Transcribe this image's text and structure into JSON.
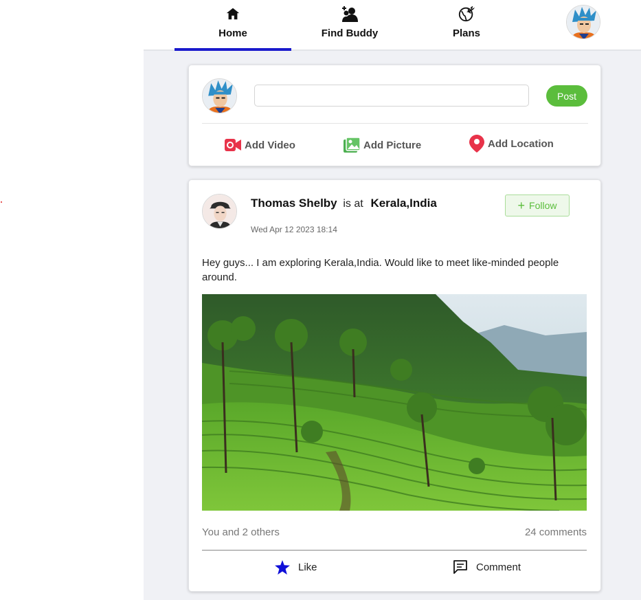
{
  "nav": {
    "items": [
      {
        "label": "Home",
        "icon": "home-icon"
      },
      {
        "label": "Find Buddy",
        "icon": "add-person-icon"
      },
      {
        "label": "Plans",
        "icon": "globe-plane-icon"
      }
    ],
    "active": "Home",
    "accent": "#1a1acc"
  },
  "composer": {
    "input_value": "",
    "post_label": "Post",
    "actions": [
      {
        "label": "Add Video",
        "icon": "video-camera-icon",
        "color": "#e8334a"
      },
      {
        "label": "Add Picture",
        "icon": "image-icon",
        "color": "#4caf50"
      },
      {
        "label": "Add Location",
        "icon": "location-pin-icon",
        "color": "#e8334a"
      }
    ]
  },
  "post": {
    "author": "Thomas Shelby",
    "is_at": "is at",
    "location": "Kerala,India",
    "timestamp": "Wed Apr 12 2023 18:14",
    "follow_label": "Follow",
    "text": "Hey guys... I am exploring Kerala,India. Would like to meet like-minded people around.",
    "likes_text": "You and 2 others",
    "comments_text": "24 comments",
    "like_label": "Like",
    "comment_label": "Comment"
  },
  "colors": {
    "post_button": "#5bbd3c",
    "like_star": "#1010d8",
    "background": "#f0f1f5"
  }
}
